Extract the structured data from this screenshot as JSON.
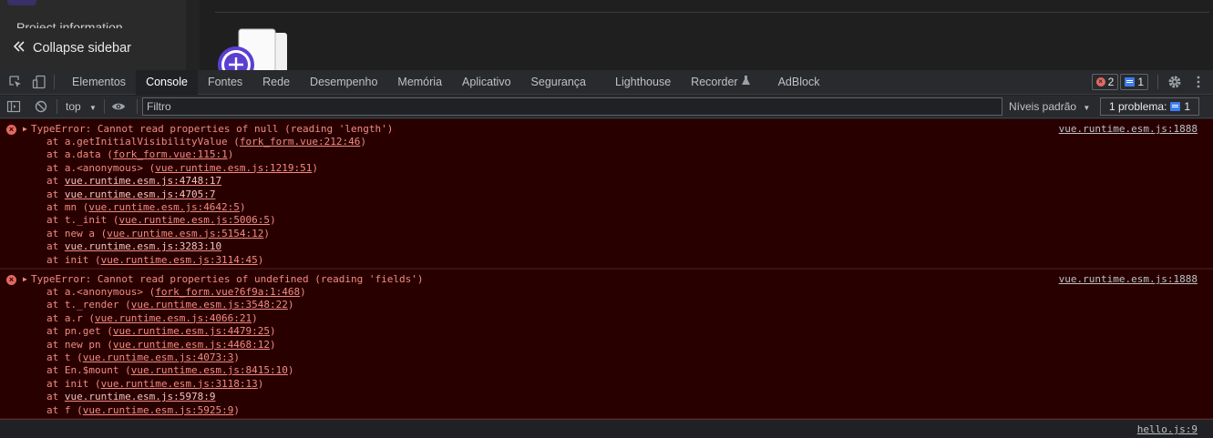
{
  "app": {
    "sidebar_item_partial": "Project information",
    "collapse_label": "Collapse sidebar"
  },
  "devtools": {
    "tabs": [
      "Elementos",
      "Console",
      "Fontes",
      "Rede",
      "Desempenho",
      "Memória",
      "Aplicativo",
      "Segurança",
      "Lighthouse",
      "Recorder",
      "AdBlock"
    ],
    "active_tab": "Console",
    "error_count": "2",
    "message_count": "1"
  },
  "toolbar": {
    "context": "top",
    "filter_placeholder": "Filtro",
    "levels_label": "Níveis padrão",
    "problems_label": "1 problema:",
    "problems_count": "1"
  },
  "messages": [
    {
      "text": "TypeError: Cannot read properties of null (reading 'length')",
      "source": "vue.runtime.esm.js:1888",
      "frames": [
        {
          "prefix": "at a.getInitialVisibilityValue (",
          "link": "fork_form.vue:212:46",
          "suffix": ")"
        },
        {
          "prefix": "at a.data (",
          "link": "fork_form.vue:115:1",
          "suffix": ")"
        },
        {
          "prefix": "at a.<anonymous> (",
          "link": "vue.runtime.esm.js:1219:51",
          "suffix": ")"
        },
        {
          "prefix": "at ",
          "link": "vue.runtime.esm.js:4748:17",
          "suffix": ""
        },
        {
          "prefix": "at ",
          "link": "vue.runtime.esm.js:4705:7",
          "suffix": ""
        },
        {
          "prefix": "at mn (",
          "link": "vue.runtime.esm.js:4642:5",
          "suffix": ")"
        },
        {
          "prefix": "at t._init (",
          "link": "vue.runtime.esm.js:5006:5",
          "suffix": ")"
        },
        {
          "prefix": "at new a (",
          "link": "vue.runtime.esm.js:5154:12",
          "suffix": ")"
        },
        {
          "prefix": "at ",
          "link": "vue.runtime.esm.js:3283:10",
          "suffix": ""
        },
        {
          "prefix": "at init (",
          "link": "vue.runtime.esm.js:3114:45",
          "suffix": ")"
        }
      ]
    },
    {
      "text": "TypeError: Cannot read properties of undefined (reading 'fields')",
      "source": "vue.runtime.esm.js:1888",
      "frames": [
        {
          "prefix": "at a.<anonymous> (",
          "link": "fork_form.vue?6f9a:1:468",
          "suffix": ")"
        },
        {
          "prefix": "at t._render (",
          "link": "vue.runtime.esm.js:3548:22",
          "suffix": ")"
        },
        {
          "prefix": "at a.r (",
          "link": "vue.runtime.esm.js:4066:21",
          "suffix": ")"
        },
        {
          "prefix": "at pn.get (",
          "link": "vue.runtime.esm.js:4479:25",
          "suffix": ")"
        },
        {
          "prefix": "at new pn (",
          "link": "vue.runtime.esm.js:4468:12",
          "suffix": ")"
        },
        {
          "prefix": "at t (",
          "link": "vue.runtime.esm.js:4073:3",
          "suffix": ")"
        },
        {
          "prefix": "at En.$mount (",
          "link": "vue.runtime.esm.js:8415:10",
          "suffix": ")"
        },
        {
          "prefix": "at init (",
          "link": "vue.runtime.esm.js:3118:13",
          "suffix": ")"
        },
        {
          "prefix": "at ",
          "link": "vue.runtime.esm.js:5978:9",
          "suffix": ""
        },
        {
          "prefix": "at f (",
          "link": "vue.runtime.esm.js:5925:9",
          "suffix": ")"
        }
      ]
    }
  ],
  "footer_source": "hello.js:9",
  "icons": {
    "inspect": "inspect-element-icon",
    "device": "device-toggle-icon",
    "settings": "gear-icon",
    "more": "kebab-menu-icon",
    "sidebar": "console-sidebar-icon",
    "clear": "clear-console-icon",
    "eye": "eye-icon",
    "collapse": "double-chevron-left-icon",
    "flask": "flask-icon"
  },
  "colors": {
    "error_bg": "#290000",
    "error_text": "#f28b82",
    "devtools_bg": "#292a2d",
    "accent_purple": "#5b3fd1"
  }
}
